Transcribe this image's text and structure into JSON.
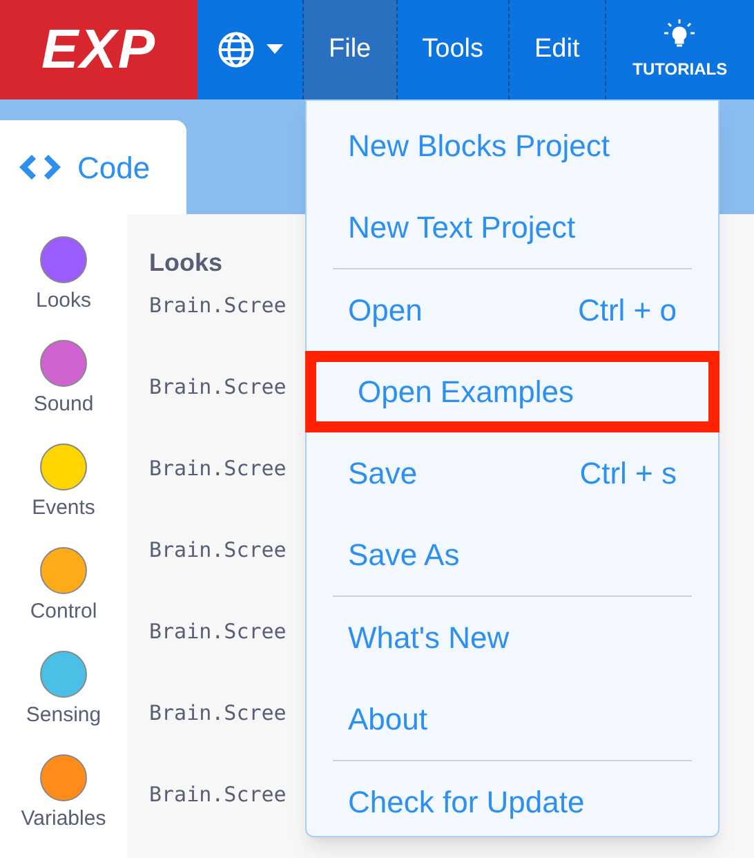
{
  "navbar": {
    "logo": "EXP",
    "menus": [
      {
        "label": "File",
        "selected": true
      },
      {
        "label": "Tools",
        "selected": false
      },
      {
        "label": "Edit",
        "selected": false
      }
    ],
    "tutorials": "TUTORIALS"
  },
  "tab": {
    "label": "Code"
  },
  "categories": [
    {
      "label": "Looks",
      "color": "#9a5cff"
    },
    {
      "label": "Sound",
      "color": "#cf63cf"
    },
    {
      "label": "Events",
      "color": "#ffd500"
    },
    {
      "label": "Control",
      "color": "#ffab19"
    },
    {
      "label": "Sensing",
      "color": "#4cbfe6"
    },
    {
      "label": "Variables",
      "color": "#ff8c1a"
    }
  ],
  "code": {
    "heading": "Looks",
    "lines": [
      "Brain.Scree",
      "Brain.Scree",
      "Brain.Scree",
      "Brain.Scree",
      "Brain.Scree",
      "Brain.Scree",
      "Brain.Scree"
    ]
  },
  "file_menu": [
    {
      "label": "New Blocks Project",
      "highlighted": false,
      "divider_after": false
    },
    {
      "label": "New Text Project",
      "highlighted": false,
      "divider_after": true
    },
    {
      "label": "Open",
      "shortcut": "Ctrl + o",
      "highlighted": false,
      "divider_after": false
    },
    {
      "label": "Open Examples",
      "highlighted": true,
      "divider_after": false
    },
    {
      "label": "Save",
      "shortcut": "Ctrl + s",
      "highlighted": false,
      "divider_after": false
    },
    {
      "label": "Save As",
      "highlighted": false,
      "divider_after": true
    },
    {
      "label": "What's New",
      "highlighted": false,
      "divider_after": false
    },
    {
      "label": "About",
      "highlighted": false,
      "divider_after": true
    },
    {
      "label": "Check for Update",
      "highlighted": false,
      "divider_after": false
    }
  ]
}
